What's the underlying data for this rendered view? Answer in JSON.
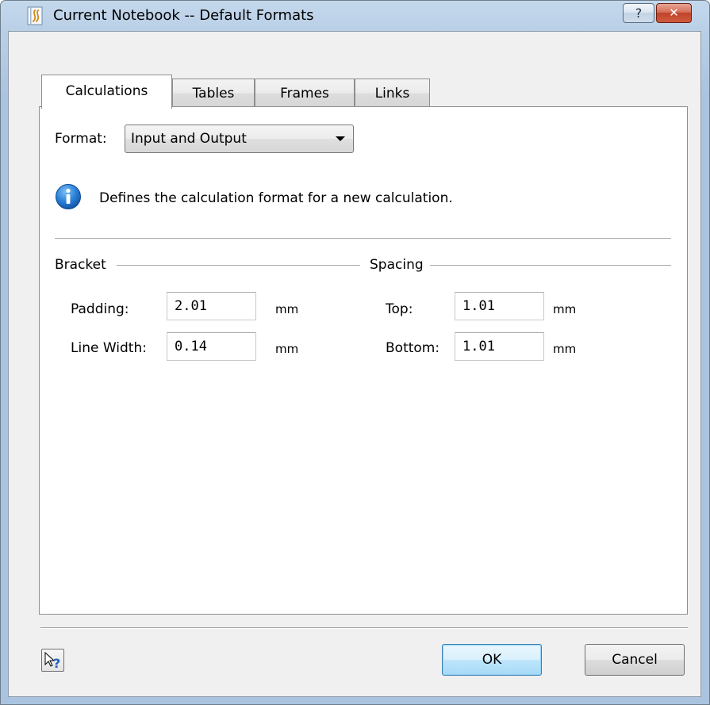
{
  "window": {
    "title": "Current Notebook -- Default Formats",
    "help_glyph": "?",
    "close_glyph": "✕",
    "app_icon": "notebook-icon"
  },
  "tabs": [
    {
      "label": "Calculations",
      "active": true
    },
    {
      "label": "Tables",
      "active": false
    },
    {
      "label": "Frames",
      "active": false
    },
    {
      "label": "Links",
      "active": false
    }
  ],
  "format": {
    "label": "Format:",
    "selected": "Input and Output"
  },
  "info": {
    "icon": "info-icon",
    "text": "Defines the calculation format for a new calculation."
  },
  "bracket": {
    "title": "Bracket",
    "padding_label": "Padding:",
    "padding_value": "2.01",
    "line_width_label": "Line Width:",
    "line_width_value": "0.14",
    "unit": "mm"
  },
  "spacing": {
    "title": "Spacing",
    "top_label": "Top:",
    "top_value": "1.01",
    "bottom_label": "Bottom:",
    "bottom_value": "1.01",
    "unit": "mm"
  },
  "buttons": {
    "ok": "OK",
    "cancel": "Cancel",
    "context_help_icon": "context-help-icon"
  },
  "colors": {
    "frame": "#aac4df",
    "client": "#f0f0f0",
    "info_blue": "#1e73c8",
    "close_red": "#c0432a"
  }
}
